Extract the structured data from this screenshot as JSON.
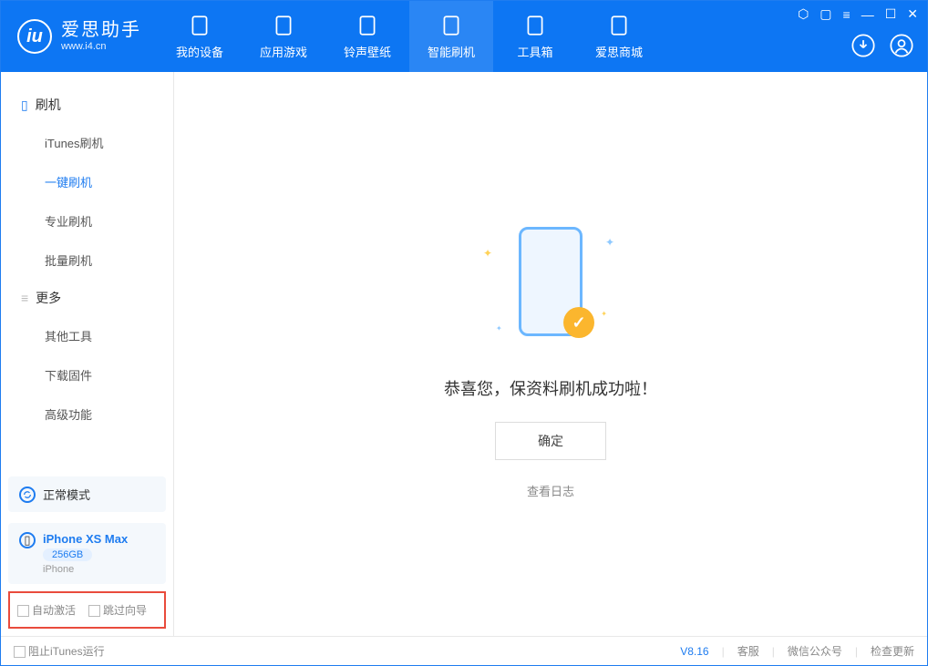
{
  "brand": {
    "title": "爱思助手",
    "sub": "www.i4.cn"
  },
  "tabs": [
    "我的设备",
    "应用游戏",
    "铃声壁纸",
    "智能刷机",
    "工具箱",
    "爱思商城"
  ],
  "activeTab": 3,
  "sidebar": {
    "sectionA": "刷机",
    "itemsA": [
      "iTunes刷机",
      "一键刷机",
      "专业刷机",
      "批量刷机"
    ],
    "activeA": 1,
    "sectionB": "更多",
    "itemsB": [
      "其他工具",
      "下载固件",
      "高级功能"
    ]
  },
  "mode": {
    "label": "正常模式"
  },
  "device": {
    "name": "iPhone XS Max",
    "storage": "256GB",
    "type": "iPhone"
  },
  "footerChecks": {
    "autoActivate": "自动激活",
    "skipGuide": "跳过向导"
  },
  "main": {
    "successText": "恭喜您，保资料刷机成功啦！",
    "confirm": "确定",
    "viewLog": "查看日志"
  },
  "status": {
    "blockItunes": "阻止iTunes运行",
    "version": "V8.16",
    "links": [
      "客服",
      "微信公众号",
      "检查更新"
    ]
  }
}
